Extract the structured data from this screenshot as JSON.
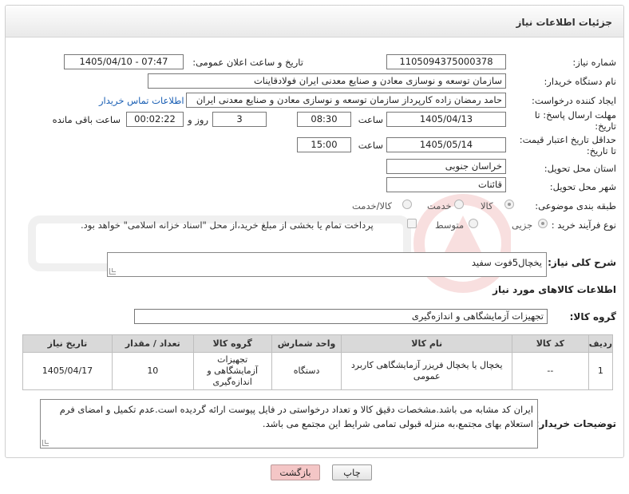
{
  "header": {
    "title": "جزئیات اطلاعات نیاز"
  },
  "fields": {
    "need_number_label": "شماره نیاز:",
    "need_number": "1105094375000378",
    "announce_label": "تاریخ و ساعت اعلان عمومی:",
    "announce_value": "1405/04/10 - 07:47",
    "buyer_org_label": "نام دستگاه خریدار:",
    "buyer_org": "سازمان توسعه و نوسازی معادن و صنایع معدنی ایران فولادقاینات",
    "creator_label": "ایجاد کننده درخواست:",
    "creator": "حامد  رمضان زاده  کارپرداز  سازمان توسعه و نوسازی معادن و صنایع معدنی ایران",
    "contact_link": "اطلاعات تماس خریدار",
    "deadline_label_1": "مهلت ارسال پاسخ: تا",
    "deadline_label_2": "تاریخ:",
    "deadline_date": "1405/04/13",
    "time_label": "ساعت",
    "deadline_time": "08:30",
    "days_value": "3",
    "days_label": "روز و",
    "remaining_value": "00:02:22",
    "remaining_label": "ساعت باقی مانده",
    "price_label_1": "حداقل تاریخ اعتبار قیمت:",
    "price_label_2": "تا تاریخ:",
    "price_date": "1405/05/14",
    "price_time": "15:00",
    "province_label": "استان محل تحویل:",
    "province": "خراسان جنوبی",
    "city_label": "شهر محل تحویل:",
    "city": "قائنات",
    "category_label": "طبقه بندی موضوعی:",
    "category_options": [
      "کالا",
      "خدمت",
      "کالا/خدمت"
    ],
    "process_label": "نوع فرآیند خرید :",
    "process_options": [
      "جزیی",
      "متوسط"
    ],
    "payment_note": "پرداخت تمام یا بخشی از مبلغ خرید،از محل \"اسناد خزانه اسلامی\" خواهد بود."
  },
  "summary": {
    "label": "شرح کلی نیاز:",
    "value": "یخچال5فوت سفید"
  },
  "goods_section": {
    "title": "اطلاعات کالاهای مورد نیاز"
  },
  "goods_group": {
    "label": "گروه کالا:",
    "value": "تجهیزات آزمایشگاهی و اندازه‌گیری"
  },
  "table": {
    "headers": [
      "ردیف",
      "کد کالا",
      "نام کالا",
      "واحد شمارش",
      "گروه کالا",
      "تعداد / مقدار",
      "تاریخ نیاز"
    ],
    "rows": [
      {
        "row": "1",
        "code": "--",
        "name": "یخچال یا یخچال فریزر آزمایشگاهی کاربرد عمومی",
        "unit": "دستگاه",
        "group": "تجهیزات آزمایشگاهی و اندازه‌گیری",
        "qty": "10",
        "date": "1405/04/17"
      }
    ]
  },
  "buyer_notes": {
    "label": "توضیحات خریدار:",
    "value": "ایران کد مشابه می باشد.مشخصات دقیق کالا و تعداد درخواستی در فایل پیوست ارائه گردیده است.عدم تکمیل و امضای فرم استعلام بهای مجتمع،به منزله قبولی تمامی شرایط این مجتمع می باشد."
  },
  "buttons": {
    "print": "چاپ",
    "back": "بازگشت"
  },
  "colors": {
    "link": "#1a5fb4",
    "back_button": "#f4c6c6",
    "header_bg": "#ececec"
  }
}
